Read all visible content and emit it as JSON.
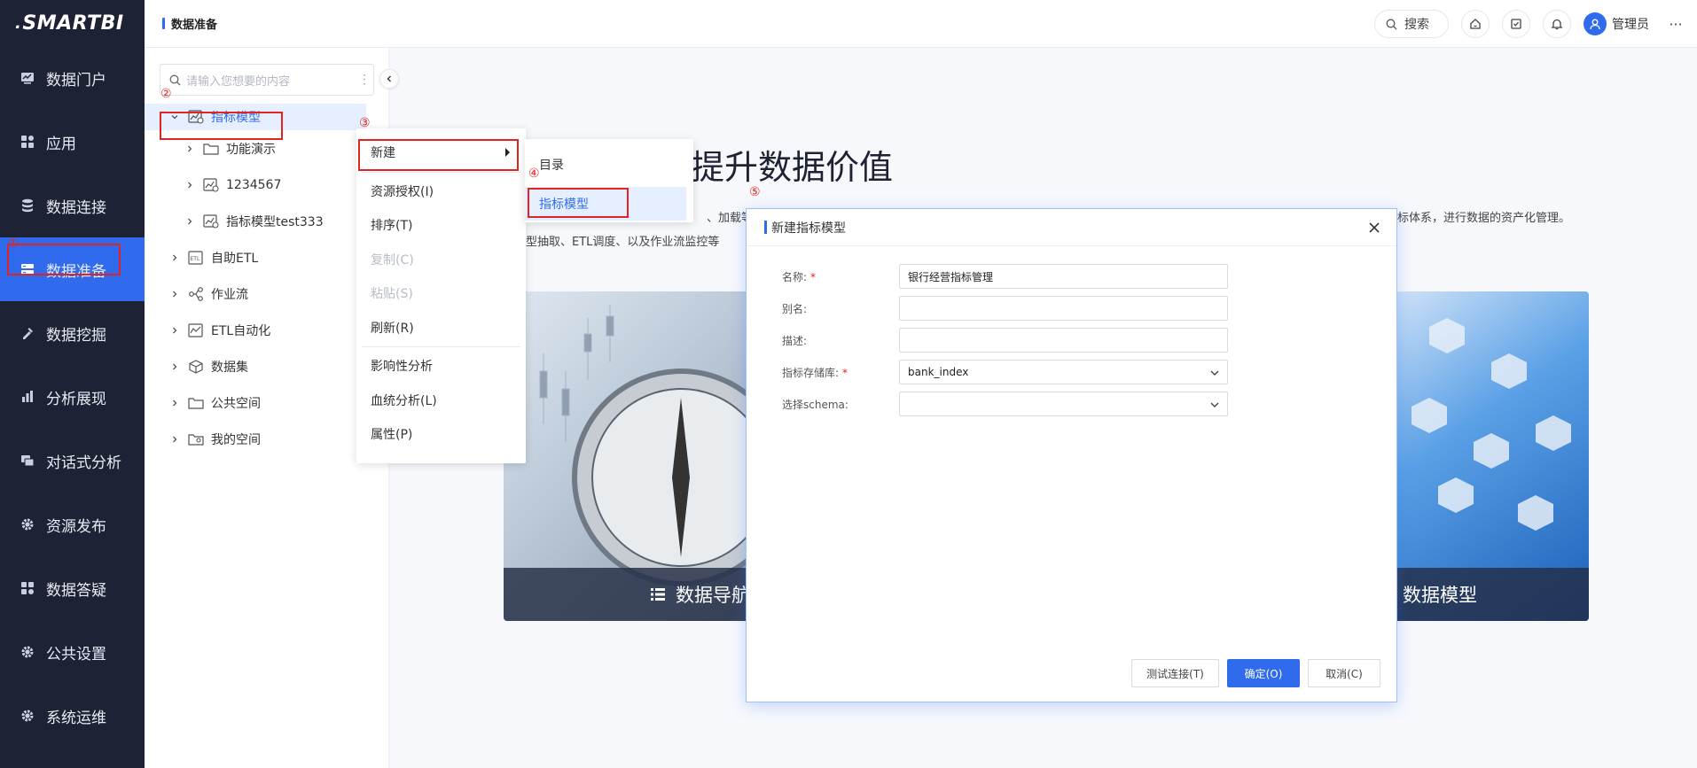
{
  "app": {
    "logo": "SMARTBI"
  },
  "sidebar": {
    "items": [
      {
        "label": "数据门户",
        "icon": "monitor-chart-icon"
      },
      {
        "label": "应用",
        "icon": "grid-apps-icon"
      },
      {
        "label": "数据连接",
        "icon": "database-icon"
      },
      {
        "label": "数据准备",
        "icon": "data-prep-icon",
        "active": true
      },
      {
        "label": "数据挖掘",
        "icon": "pickaxe-icon"
      },
      {
        "label": "分析展现",
        "icon": "bar-chart-icon"
      },
      {
        "label": "对话式分析",
        "icon": "chat-icon"
      },
      {
        "label": "资源发布",
        "icon": "gear-icon"
      },
      {
        "label": "数据答疑",
        "icon": "grid-apps-icon"
      },
      {
        "label": "公共设置",
        "icon": "gear-icon"
      },
      {
        "label": "系统运维",
        "icon": "gear-icon"
      }
    ]
  },
  "steps": {
    "s1": "①",
    "s2": "②",
    "s3": "③",
    "s4": "④",
    "s5": "⑤"
  },
  "header": {
    "breadcrumb": "数据准备",
    "search_label": "搜索",
    "user_name": "管理员",
    "more": "···"
  },
  "tree": {
    "search_placeholder": "请输入您想要的内容",
    "nodes": [
      {
        "label": "指标模型",
        "icon": "index-model-icon",
        "expanded": true,
        "selected": true
      },
      {
        "label": "功能演示",
        "icon": "folder-icon",
        "level": 1
      },
      {
        "label": "1234567",
        "icon": "index-model-icon",
        "level": 1
      },
      {
        "label": "指标模型test333",
        "icon": "index-model-icon",
        "level": 1
      },
      {
        "label": "自助ETL",
        "icon": "etl-icon"
      },
      {
        "label": "作业流",
        "icon": "workflow-icon"
      },
      {
        "label": "ETL自动化",
        "icon": "etl-auto-icon"
      },
      {
        "label": "数据集",
        "icon": "cube-icon"
      },
      {
        "label": "公共空间",
        "icon": "folder-icon"
      },
      {
        "label": "我的空间",
        "icon": "my-space-icon"
      }
    ]
  },
  "background": {
    "title_fragment": "提升数据价值",
    "text1": "、加载等",
    "text2": "标体系，进行数据的资产化管理。",
    "text3": "据模型抽取、ETL调度、以及作业流监控等",
    "card_left_caption": "数据导航",
    "card_right_caption": "数据模型"
  },
  "context_menu": {
    "items": [
      {
        "label": "新建",
        "submenu": true
      },
      {
        "label": "资源授权(I)"
      },
      {
        "label": "排序(T)"
      },
      {
        "label": "复制(C)",
        "disabled": true
      },
      {
        "label": "粘贴(S)",
        "disabled": true
      },
      {
        "label": "刷新(R)"
      },
      {
        "label": "影响性分析"
      },
      {
        "label": "血统分析(L)"
      },
      {
        "label": "属性(P)"
      }
    ],
    "submenu": [
      {
        "label": "目录"
      },
      {
        "label": "指标模型",
        "hover": true
      }
    ]
  },
  "dialog": {
    "title": "新建指标模型",
    "fields": [
      {
        "label": "名称:",
        "required": true,
        "value": "银行经营指标管理",
        "type": "text"
      },
      {
        "label": "别名:",
        "required": false,
        "value": "",
        "type": "text"
      },
      {
        "label": "描述:",
        "required": false,
        "value": "",
        "type": "text"
      },
      {
        "label": "指标存储库:",
        "required": true,
        "value": "bank_index",
        "type": "select"
      },
      {
        "label": "选择schema:",
        "required": false,
        "value": "",
        "type": "select"
      }
    ],
    "buttons": {
      "test": "测试连接(T)",
      "ok": "确定(O)",
      "cancel": "取消(C)"
    }
  },
  "colors": {
    "accent": "#2f6bec",
    "sidebar_bg": "#1d2235",
    "highlight": "#e02424"
  }
}
